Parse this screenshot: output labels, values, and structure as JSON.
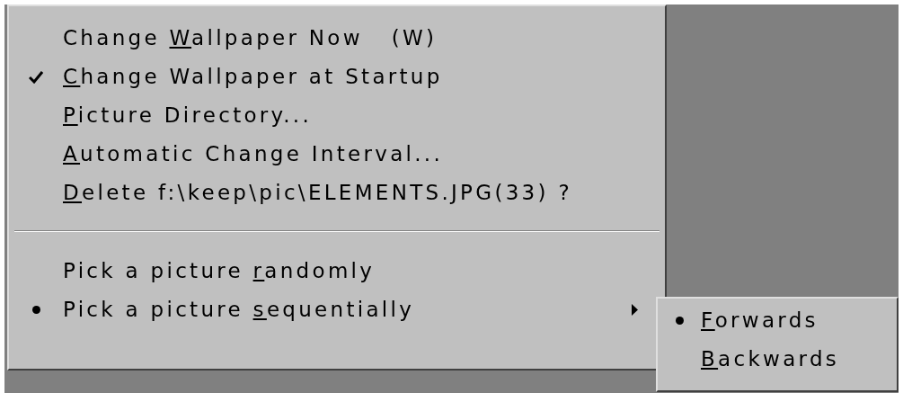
{
  "menu": {
    "items": [
      {
        "kind": "command",
        "text_before": "Change ",
        "mnemonic": "W",
        "text_after": "allpaper Now   (W)"
      },
      {
        "kind": "check",
        "checked": true,
        "mnemonic": "C",
        "text_after": "hange Wallpaper at Startup"
      },
      {
        "kind": "command",
        "mnemonic": "P",
        "text_after": "icture Directory..."
      },
      {
        "kind": "command",
        "mnemonic": "A",
        "text_after": "utomatic Change Interval..."
      },
      {
        "kind": "command",
        "mnemonic": "D",
        "text_after": "elete f:\\keep\\pic\\ELEMENTS.JPG(33) ?"
      },
      {
        "kind": "separator"
      },
      {
        "kind": "radio",
        "selected": false,
        "text_before": "Pick a picture ",
        "mnemonic": "r",
        "text_after": "andomly"
      },
      {
        "kind": "radio",
        "selected": true,
        "has_submenu": true,
        "text_before": "Pick a picture ",
        "mnemonic": "s",
        "text_after": "equentially"
      }
    ]
  },
  "submenu": {
    "items": [
      {
        "kind": "radio",
        "selected": true,
        "mnemonic": "F",
        "text_after": "orwards"
      },
      {
        "kind": "radio",
        "selected": false,
        "mnemonic": "B",
        "text_after": "ackwards"
      }
    ]
  }
}
